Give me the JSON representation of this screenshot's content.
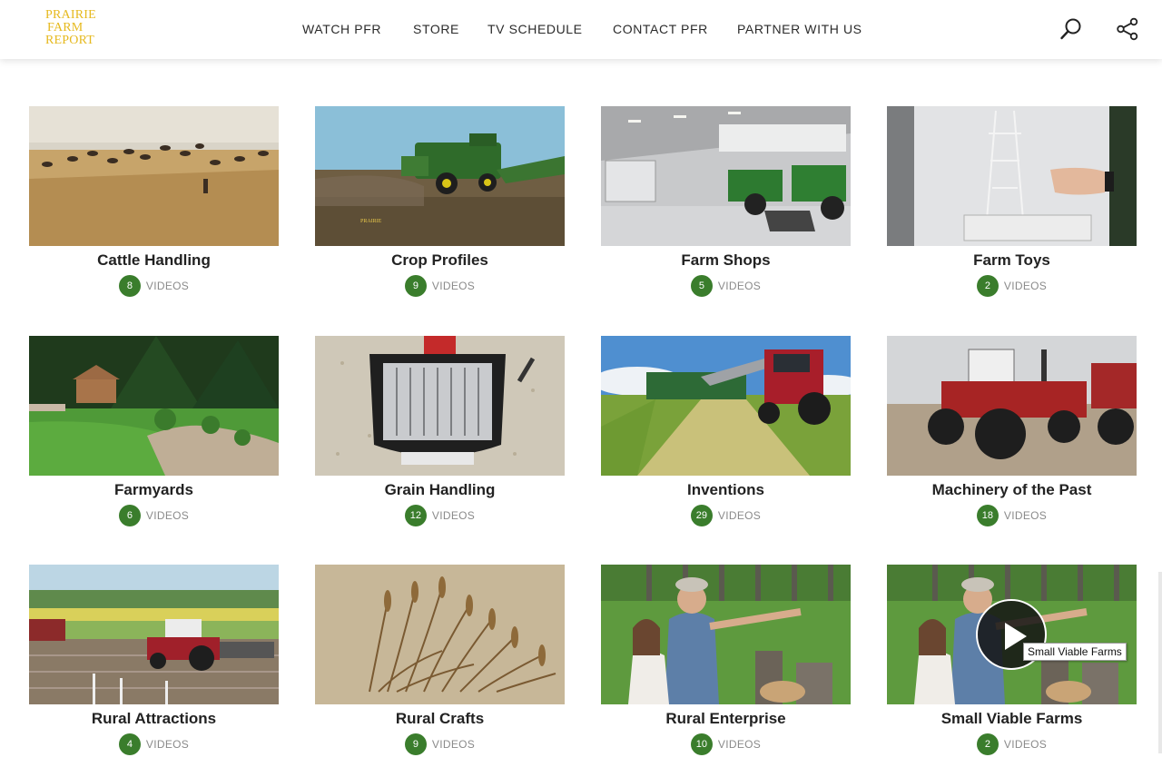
{
  "header": {
    "logo_lines": [
      "PRAIRIE",
      "FARM",
      "REPORT"
    ],
    "nav": [
      "WATCH PFR",
      "STORE",
      "TV SCHEDULE",
      "CONTACT PFR",
      "PARTNER WITH US"
    ],
    "icons": [
      "search-icon",
      "share-icon"
    ]
  },
  "colors": {
    "accent_green": "#3a7d2c",
    "logo_gold": "#e6b91e",
    "count_label": "#8a8a8a"
  },
  "videos_label": "VIDEOS",
  "categories": [
    {
      "title": "Cattle Handling",
      "count": "8",
      "image": "cattle-in-cornfield"
    },
    {
      "title": "Crop Profiles",
      "count": "9",
      "image": "green-combine-harvester"
    },
    {
      "title": "Farm Shops",
      "count": "5",
      "image": "tractors-in-shop"
    },
    {
      "title": "Farm Toys",
      "count": "2",
      "image": "model-drilling-rig"
    },
    {
      "title": "Farmyards",
      "count": "6",
      "image": "gazebo-garden"
    },
    {
      "title": "Grain Handling",
      "count": "12",
      "image": "grain-auger-screen"
    },
    {
      "title": "Inventions",
      "count": "29",
      "image": "red-tractor-hay"
    },
    {
      "title": "Machinery of the Past",
      "count": "18",
      "image": "vintage-4wd-tractor"
    },
    {
      "title": "Rural Attractions",
      "count": "4",
      "image": "tractor-field-plots"
    },
    {
      "title": "Rural Crafts",
      "count": "9",
      "image": "wheat-straw-art"
    },
    {
      "title": "Rural Enterprise",
      "count": "10",
      "image": "couple-at-fence"
    },
    {
      "title": "Small Viable Farms",
      "count": "2",
      "image": "couple-at-fence"
    }
  ],
  "tooltip": "Small Viable Farms"
}
